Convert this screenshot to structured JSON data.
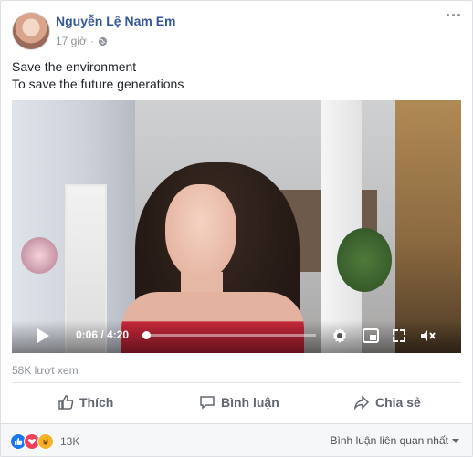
{
  "post": {
    "author": "Nguyễn Lệ Nam Em",
    "time": "17 giờ",
    "separator": "·",
    "audience_icon": "globe-icon",
    "more_icon": "more-options-icon",
    "text_lines": [
      "Save the environment",
      "To save the future generations"
    ]
  },
  "video": {
    "current_time": "0:06",
    "duration": "4:20",
    "time_display": "0:06 / 4:20",
    "progress_fraction": 0.023
  },
  "stats": {
    "views": "58K lượt xem"
  },
  "actions": {
    "like": "Thích",
    "comment": "Bình luận",
    "share": "Chia sẻ"
  },
  "footer": {
    "reactions": [
      "like",
      "love",
      "haha"
    ],
    "reaction_count": "13K",
    "sort_label": "Bình luận liên quan nhất"
  },
  "colors": {
    "link": "#365899",
    "like": "#1877f2",
    "love": "#f33e58",
    "haha": "#f7b125"
  }
}
